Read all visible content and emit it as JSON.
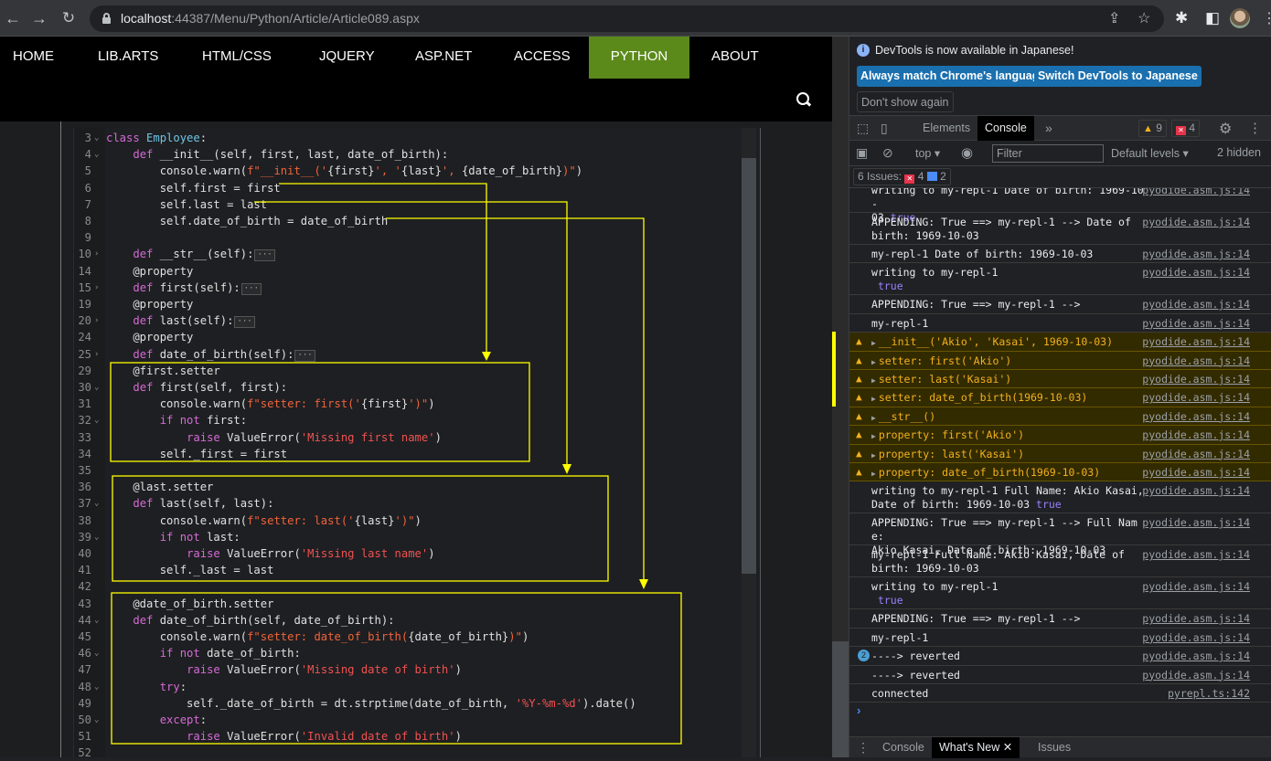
{
  "browser": {
    "url_host": "localhost",
    "url_rest": ":44387/Menu/Python/Article/Article089.aspx"
  },
  "site": {
    "nav": [
      {
        "label": "HOME",
        "active": false
      },
      {
        "label": "LIB.ARTS",
        "active": false
      },
      {
        "label": "HTML/CSS",
        "active": false
      },
      {
        "label": "JQUERY",
        "active": false
      },
      {
        "label": "ASP.NET",
        "active": false
      },
      {
        "label": "ACCESS",
        "active": false
      },
      {
        "label": "PYTHON",
        "active": true
      },
      {
        "label": "ABOUT",
        "active": false
      }
    ],
    "accent_color": "#5b8a1a"
  },
  "editor": {
    "lines": [
      {
        "n": "3",
        "fold": "v",
        "code": "<span class='kw'>class</span> <span class='cls'>Employee</span>:"
      },
      {
        "n": "4",
        "fold": "v",
        "code": "    <span class='kw'>def</span> __init__(self, first, last, date_of_birth):"
      },
      {
        "n": "5",
        "fold": "",
        "code": "        console.warn(<span class='str'>f\"__init__('</span>{first}<span class='str'>', '</span>{last}<span class='str'>', </span>{date_of_birth}<span class='str'>)\"</span>)"
      },
      {
        "n": "6",
        "fold": "",
        "code": "        self.first = first"
      },
      {
        "n": "7",
        "fold": "",
        "code": "        self.last = last"
      },
      {
        "n": "8",
        "fold": "",
        "code": "        self.date_of_birth = date_of_birth"
      },
      {
        "n": "9",
        "fold": "",
        "code": ""
      },
      {
        "n": "10",
        "fold": ">",
        "code": "    <span class='kw'>def</span> __str__(self):<span class='dots'>···</span>"
      },
      {
        "n": "14",
        "fold": "",
        "code": "    @property"
      },
      {
        "n": "15",
        "fold": ">",
        "code": "    <span class='kw'>def</span> first(self):<span class='dots'>···</span>"
      },
      {
        "n": "19",
        "fold": "",
        "code": "    @property"
      },
      {
        "n": "20",
        "fold": ">",
        "code": "    <span class='kw'>def</span> last(self):<span class='dots'>···</span>"
      },
      {
        "n": "24",
        "fold": "",
        "code": "    @property"
      },
      {
        "n": "25",
        "fold": ">",
        "code": "    <span class='kw'>def</span> date_of_birth(self):<span class='dots'>···</span>"
      },
      {
        "n": "29",
        "fold": "",
        "code": "    @first.setter"
      },
      {
        "n": "30",
        "fold": "v",
        "code": "    <span class='kw'>def</span> first(self, first):"
      },
      {
        "n": "31",
        "fold": "",
        "code": "        console.warn(<span class='str'>f\"setter: first('</span>{first}<span class='str'>')\"</span>)"
      },
      {
        "n": "32",
        "fold": "v",
        "code": "        <span class='kw'>if not</span> first:"
      },
      {
        "n": "33",
        "fold": "",
        "code": "            <span class='kw'>raise</span> ValueError(<span class='str2'>'Missing first name'</span>)"
      },
      {
        "n": "34",
        "fold": "",
        "code": "        self._first = first"
      },
      {
        "n": "35",
        "fold": "",
        "code": ""
      },
      {
        "n": "36",
        "fold": "",
        "code": "    @last.setter"
      },
      {
        "n": "37",
        "fold": "v",
        "code": "    <span class='kw'>def</span> last(self, last):"
      },
      {
        "n": "38",
        "fold": "",
        "code": "        console.warn(<span class='str'>f\"setter: last('</span>{last}<span class='str'>')\"</span>)"
      },
      {
        "n": "39",
        "fold": "v",
        "code": "        <span class='kw'>if not</span> last:"
      },
      {
        "n": "40",
        "fold": "",
        "code": "            <span class='kw'>raise</span> ValueError(<span class='str2'>'Missing last name'</span>)"
      },
      {
        "n": "41",
        "fold": "",
        "code": "        self._last = last"
      },
      {
        "n": "42",
        "fold": "",
        "code": ""
      },
      {
        "n": "43",
        "fold": "",
        "code": "    @date_of_birth.setter"
      },
      {
        "n": "44",
        "fold": "v",
        "code": "    <span class='kw'>def</span> date_of_birth(self, date_of_birth):"
      },
      {
        "n": "45",
        "fold": "",
        "code": "        console.warn(<span class='str'>f\"setter: date_of_birth(</span>{date_of_birth}<span class='str'>)\"</span>)"
      },
      {
        "n": "46",
        "fold": "v",
        "code": "        <span class='kw'>if not</span> date_of_birth:"
      },
      {
        "n": "47",
        "fold": "",
        "code": "            <span class='kw'>raise</span> ValueError(<span class='str2'>'Missing date of birth'</span>)"
      },
      {
        "n": "48",
        "fold": "v",
        "code": "        <span class='kw'>try</span>:"
      },
      {
        "n": "49",
        "fold": "",
        "code": "            self._date_of_birth = dt.strptime(date_of_birth, <span class='str2'>'%Y-%m-%d'</span>).date()"
      },
      {
        "n": "50",
        "fold": "v",
        "code": "        <span class='kw'>except</span>:"
      },
      {
        "n": "51",
        "fold": "",
        "code": "            <span class='kw'>raise</span> ValueError(<span class='str2'>'Invalid date of birth'</span>)"
      },
      {
        "n": "52",
        "fold": "",
        "code": ""
      }
    ],
    "annotation_color": "#ffff00"
  },
  "devtools": {
    "info_text": "DevTools is now available in Japanese!",
    "btn_always": "Always match Chrome's language",
    "btn_switch": "Switch DevTools to Japanese",
    "btn_dont_show": "Don't show again",
    "tab_elements": "Elements",
    "tab_console": "Console",
    "more_tabs": "»",
    "warning_count": "9",
    "error_count": "4",
    "context": "top ▾",
    "filter_placeholder": "Filter",
    "levels": "Default levels ▾",
    "hidden": "2 hidden",
    "issues_label": "6 Issues:",
    "issues_errors": "4",
    "issues_info": "2",
    "messages": [
      {
        "type": "log",
        "text": "writing to my-repl-1 Date of birth: 1969-10-\n03 ",
        "bool": "true",
        "src": "pyodide.asm.js:14",
        "lines": 2
      },
      {
        "type": "log",
        "text": "APPENDING: True ==> my-repl-1 --> Date of\nbirth: 1969-10-03",
        "src": "pyodide.asm.js:14",
        "lines": 2
      },
      {
        "type": "log",
        "text": "my-repl-1 Date of birth: 1969-10-03",
        "src": "pyodide.asm.js:14",
        "lines": 1
      },
      {
        "type": "log",
        "text": "writing to my-repl-1\n ",
        "bool": "true",
        "src": "pyodide.asm.js:14",
        "lines": 2
      },
      {
        "type": "log",
        "text": "APPENDING: True ==> my-repl-1 -->",
        "src": "pyodide.asm.js:14",
        "lines": 1
      },
      {
        "type": "log",
        "text": "my-repl-1",
        "src": "pyodide.asm.js:14",
        "lines": 1
      },
      {
        "type": "warn",
        "text": "__init__('Akio', 'Kasai', 1969-10-03)",
        "src": "pyodide.asm.js:14",
        "lines": 1
      },
      {
        "type": "warn",
        "text": "setter: first('Akio')",
        "src": "pyodide.asm.js:14",
        "lines": 1
      },
      {
        "type": "warn",
        "text": "setter: last('Kasai')",
        "src": "pyodide.asm.js:14",
        "lines": 1
      },
      {
        "type": "warn",
        "text": "setter: date_of_birth(1969-10-03)",
        "src": "pyodide.asm.js:14",
        "lines": 1
      },
      {
        "type": "warn",
        "text": "__str__()",
        "src": "pyodide.asm.js:14",
        "lines": 1
      },
      {
        "type": "warn",
        "text": "property: first('Akio')",
        "src": "pyodide.asm.js:14",
        "lines": 1
      },
      {
        "type": "warn",
        "text": "property: last('Kasai')",
        "src": "pyodide.asm.js:14",
        "lines": 1
      },
      {
        "type": "warn",
        "text": "property: date_of_birth(1969-10-03)",
        "src": "pyodide.asm.js:14",
        "lines": 1
      },
      {
        "type": "log",
        "text": "writing to my-repl-1 Full Name: Akio Kasai,\nDate of birth: 1969-10-03 ",
        "bool": "true",
        "src": "pyodide.asm.js:14",
        "lines": 2
      },
      {
        "type": "log",
        "text": "APPENDING: True ==> my-repl-1 --> Full Name:\nAkio Kasai, Date of birth: 1969-10-03",
        "src": "pyodide.asm.js:14",
        "lines": 2
      },
      {
        "type": "log",
        "text": "my-repl-1 Full Name: Akio Kasai, Date of\nbirth: 1969-10-03",
        "src": "pyodide.asm.js:14",
        "lines": 2
      },
      {
        "type": "log",
        "text": "writing to my-repl-1\n ",
        "bool": "true",
        "src": "pyodide.asm.js:14",
        "lines": 2
      },
      {
        "type": "log",
        "text": "APPENDING: True ==> my-repl-1 -->",
        "src": "pyodide.asm.js:14",
        "lines": 1
      },
      {
        "type": "log",
        "text": "my-repl-1",
        "src": "pyodide.asm.js:14",
        "lines": 1
      },
      {
        "type": "log",
        "text": "----> reverted",
        "repeat": "2",
        "src": "pyodide.asm.js:14",
        "lines": 1
      },
      {
        "type": "log",
        "text": "----> reverted",
        "src": "pyodide.asm.js:14",
        "lines": 1
      },
      {
        "type": "log",
        "text": "connected",
        "src": "pyrepl.ts:142",
        "lines": 1
      }
    ],
    "prompt": "›",
    "drawer_console": "Console",
    "drawer_whatsnew": "What's New",
    "drawer_issues": "Issues"
  }
}
